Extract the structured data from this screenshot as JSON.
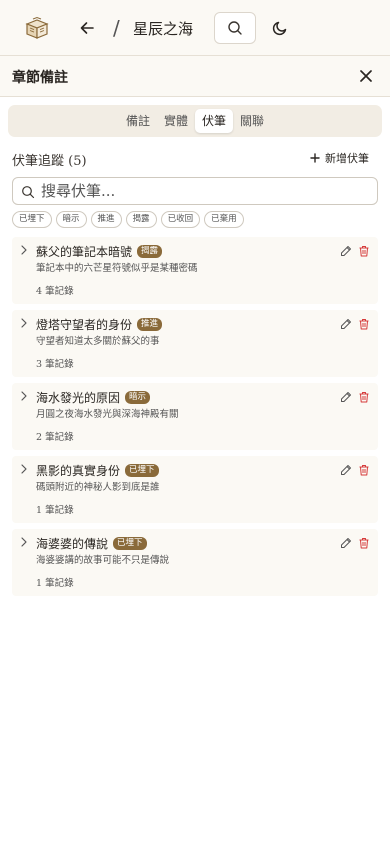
{
  "app": {
    "book_title": "星辰之海",
    "breadcrumb_separator": "/",
    "logo_icon": "book-stack-icon",
    "back_icon": "arrow-left-icon",
    "search_icon": "search-icon",
    "theme_icon": "moon-icon"
  },
  "panel": {
    "title": "章節備註",
    "close_icon": "close-icon"
  },
  "tabs": [
    {
      "label": "備註",
      "active": false
    },
    {
      "label": "實體",
      "active": false
    },
    {
      "label": "伏筆",
      "active": true
    },
    {
      "label": "關聯",
      "active": false
    }
  ],
  "section": {
    "title": "伏筆追蹤 (5)",
    "add_label": "新增伏筆",
    "add_icon": "plus-icon"
  },
  "search": {
    "placeholder": "搜尋伏筆...",
    "value": ""
  },
  "filters": [
    "已埋下",
    "暗示",
    "推進",
    "揭露",
    "已收回",
    "已棄用"
  ],
  "items": [
    {
      "title": "蘇父的筆記本暗號",
      "badge": "揭露",
      "description": "筆記本中的六芒星符號似乎是某種密碼",
      "count": "4 筆記錄"
    },
    {
      "title": "燈塔守望者的身份",
      "badge": "推進",
      "description": "守望者知道太多關於蘇父的事",
      "count": "3 筆記錄"
    },
    {
      "title": "海水發光的原因",
      "badge": "暗示",
      "description": "月圓之夜海水發光與深海神殿有關",
      "count": "2 筆記錄"
    },
    {
      "title": "黑影的真實身份",
      "badge": "已埋下",
      "description": "碼頭附近的神秘人影到底是誰",
      "count": "1 筆記錄"
    },
    {
      "title": "海婆婆的傳說",
      "badge": "已埋下",
      "description": "海婆婆講的故事可能不只是傳說",
      "count": "1 筆記錄"
    }
  ],
  "colors": {
    "background": "#fbf9f4",
    "badge": "#8a6a3a",
    "delete": "#d63a3a",
    "border": "#e6e0d5"
  }
}
